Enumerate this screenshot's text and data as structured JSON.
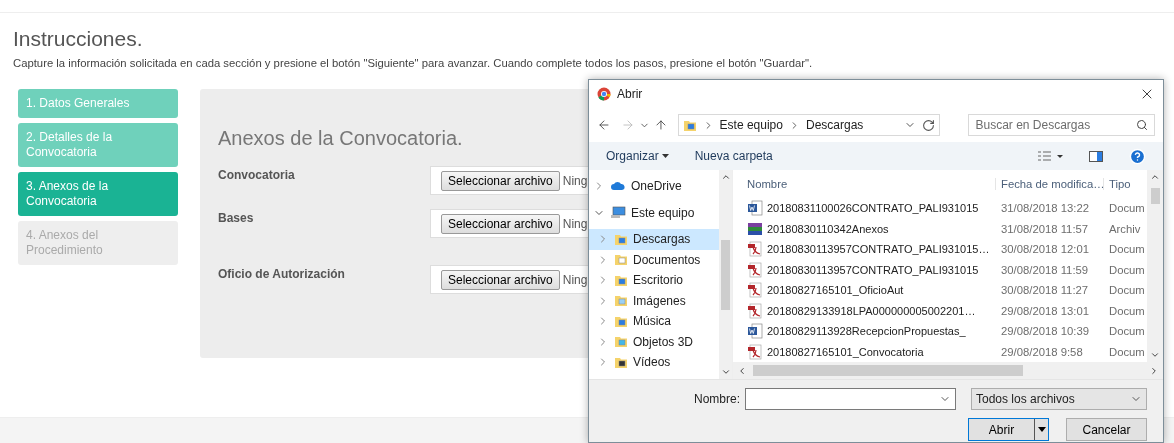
{
  "page": {
    "title": "Instrucciones.",
    "instructions": "Capture la información solicitada en cada sección y presione el botón \"Siguiente\" para avanzar. Cuando complete todos los pasos, presione el botón \"Guardar\"."
  },
  "steps": [
    {
      "label": "1. Datos Generales",
      "selected": false,
      "disabled": false
    },
    {
      "label": "2. Detalles de la Convocatoria",
      "selected": false,
      "disabled": false
    },
    {
      "label": "3. Anexos de la Convocatoria",
      "selected": true,
      "disabled": false
    },
    {
      "label": "4. Anexos del Procedimiento",
      "selected": false,
      "disabled": true
    }
  ],
  "panel": {
    "title": "Anexos de la Convocatoria.",
    "fields": [
      {
        "label": "Convocatoria",
        "button": "Seleccionar archivo",
        "status": "Ning"
      },
      {
        "label": "Bases",
        "button": "Seleccionar archivo",
        "status": "Ning"
      },
      {
        "label": "Oficio de Autorización",
        "button": "Seleccionar archivo",
        "status": "Ning"
      }
    ]
  },
  "dialog": {
    "title": "Abrir",
    "path": [
      "Este equipo",
      "Descargas"
    ],
    "search": {
      "placeholder": "Buscar en Descargas"
    },
    "toolbar": {
      "organize": "Organizar",
      "new_folder": "Nueva carpeta"
    },
    "nav": [
      {
        "label": "OneDrive",
        "kind": "cloud",
        "expanded": false,
        "selected": false
      },
      {
        "label": "Este equipo",
        "kind": "pc",
        "expanded": true,
        "selected": false,
        "children": [
          {
            "label": "Descargas",
            "kind": "downloads",
            "expanded": false,
            "selected": true
          },
          {
            "label": "Documentos",
            "kind": "documents",
            "expanded": false,
            "selected": false
          },
          {
            "label": "Escritorio",
            "kind": "desktop",
            "expanded": false,
            "selected": false
          },
          {
            "label": "Imágenes",
            "kind": "pictures",
            "expanded": false,
            "selected": false
          },
          {
            "label": "Música",
            "kind": "music",
            "expanded": false,
            "selected": false
          },
          {
            "label": "Objetos 3D",
            "kind": "objects",
            "expanded": false,
            "selected": false
          },
          {
            "label": "Vídeos",
            "kind": "videos",
            "expanded": false,
            "selected": false
          }
        ]
      }
    ],
    "columns": [
      "Nombre",
      "Fecha de modifica…",
      "Tipo"
    ],
    "files": [
      {
        "name": "20180831100026CONTRATO_PALI931015",
        "date": "31/08/2018 13:22",
        "type": "Docum",
        "kind": "word"
      },
      {
        "name": "20180830110342Anexos",
        "date": "31/08/2018 11:57",
        "type": "Archiv",
        "kind": "archive"
      },
      {
        "name": "20180830113957CONTRATO_PALI931015…",
        "date": "30/08/2018 12:01",
        "type": "Docum",
        "kind": "pdf"
      },
      {
        "name": "20180830113957CONTRATO_PALI931015",
        "date": "30/08/2018 11:59",
        "type": "Docum",
        "kind": "pdf"
      },
      {
        "name": "20180827165101_OficioAut",
        "date": "30/08/2018 11:27",
        "type": "Docum",
        "kind": "pdf"
      },
      {
        "name": "20180829133918LPA000000005002201…",
        "date": "29/08/2018 13:01",
        "type": "Docum",
        "kind": "pdf"
      },
      {
        "name": "20180829113928RecepcionPropuestas_",
        "date": "29/08/2018 10:39",
        "type": "Docum",
        "kind": "word"
      },
      {
        "name": "20180827165101_Convocatoria",
        "date": "29/08/2018 9:58",
        "type": "Docum",
        "kind": "pdf"
      }
    ],
    "name_label": "Nombre:",
    "filter": "Todos los archivos",
    "buttons": {
      "open": "Abrir",
      "cancel": "Cancelar"
    }
  }
}
